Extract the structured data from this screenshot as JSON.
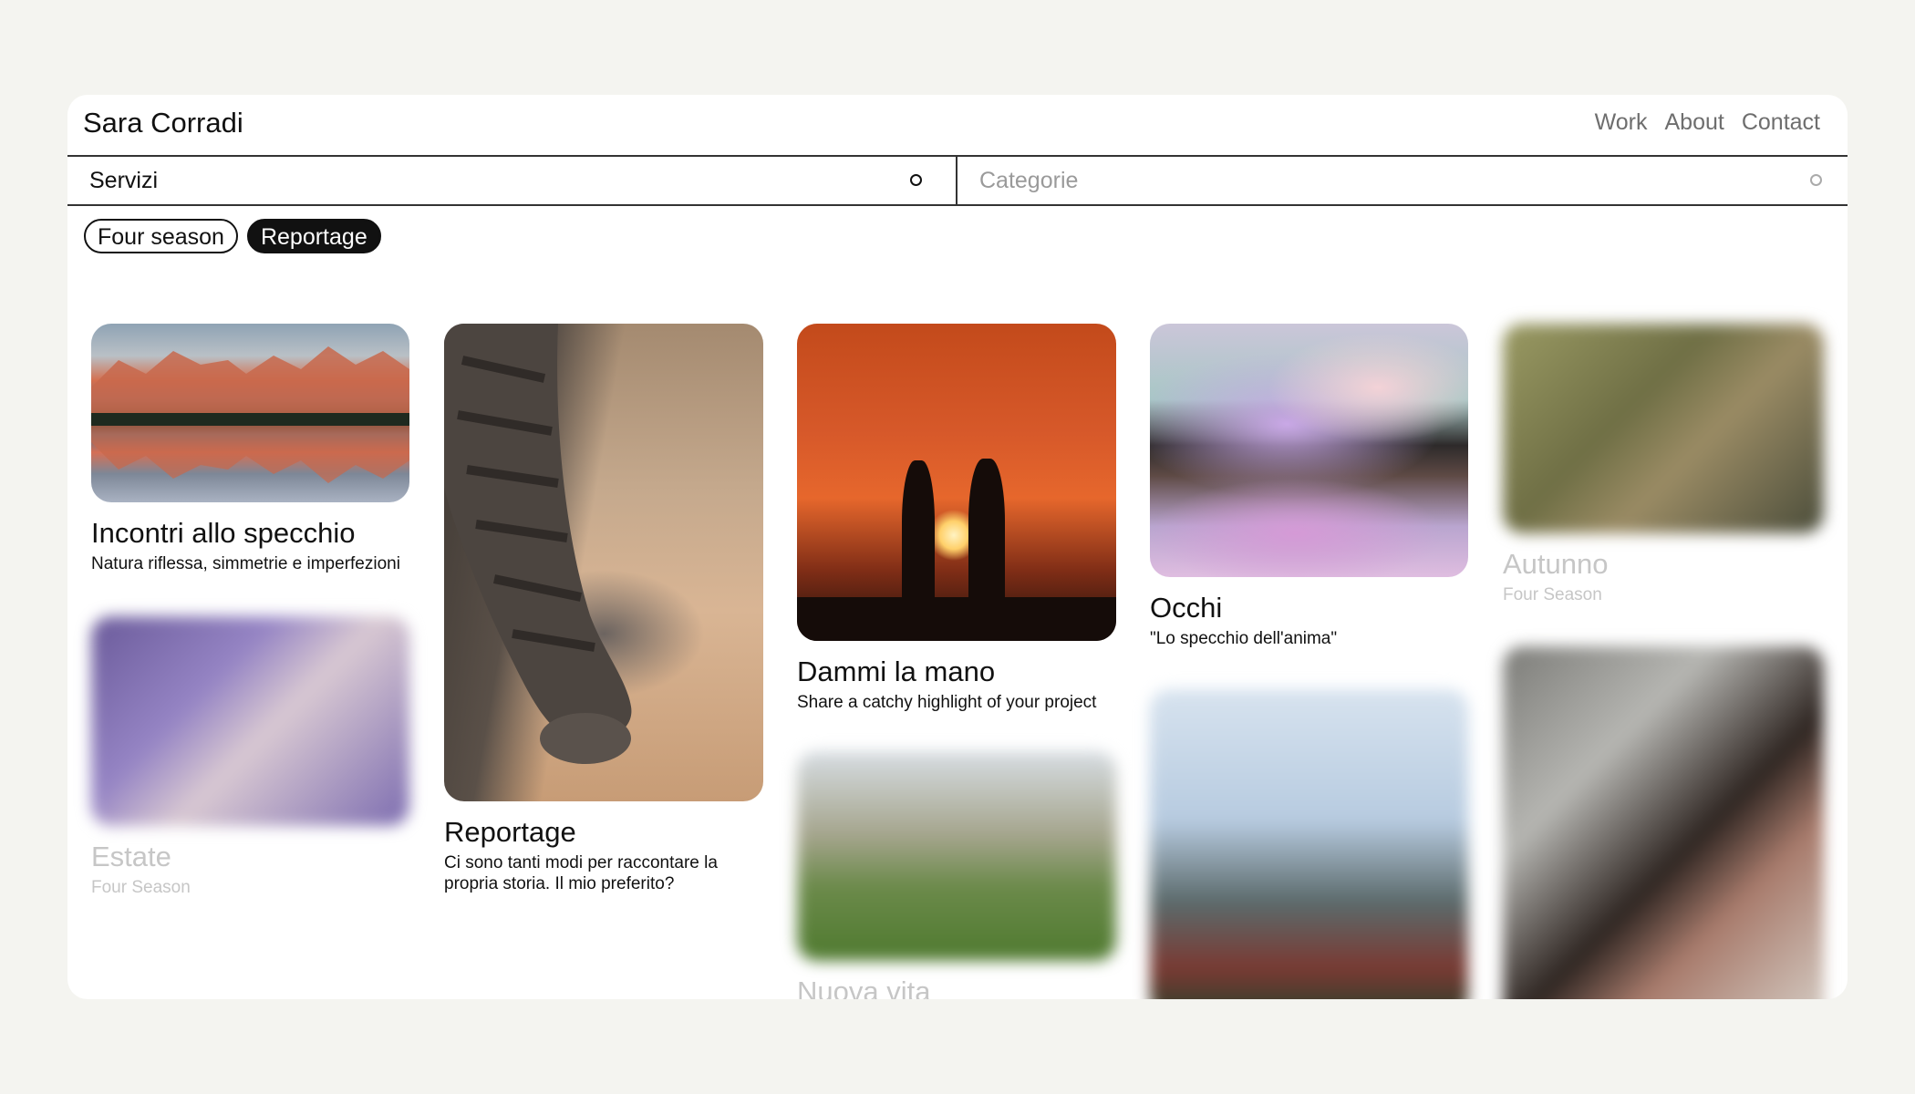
{
  "header": {
    "brand": "Sara Corradi",
    "nav": [
      "Work",
      "About",
      "Contact"
    ]
  },
  "filters": {
    "services_label": "Servizi",
    "categories_label": "Categorie"
  },
  "chips": [
    "Four season",
    "Reportage"
  ],
  "cards": {
    "incontri": {
      "title": "Incontri allo specchio",
      "desc": "Natura riflessa, simmetrie e imperfezioni"
    },
    "estate": {
      "title": "Estate",
      "desc": "Four Season"
    },
    "reportage": {
      "title": "Reportage",
      "desc_line1": "Ci sono tanti modi per raccontare la",
      "desc_line2": "propria storia. Il mio preferito?"
    },
    "dammi": {
      "title": "Dammi la mano",
      "desc": "Share a catchy highlight of your project"
    },
    "nuova": {
      "title": "Nuova vita"
    },
    "occhi": {
      "title": "Occhi",
      "desc": "\"Lo specchio dell'anima\""
    },
    "autunno": {
      "title": "Autunno",
      "desc": "Four Season"
    }
  }
}
